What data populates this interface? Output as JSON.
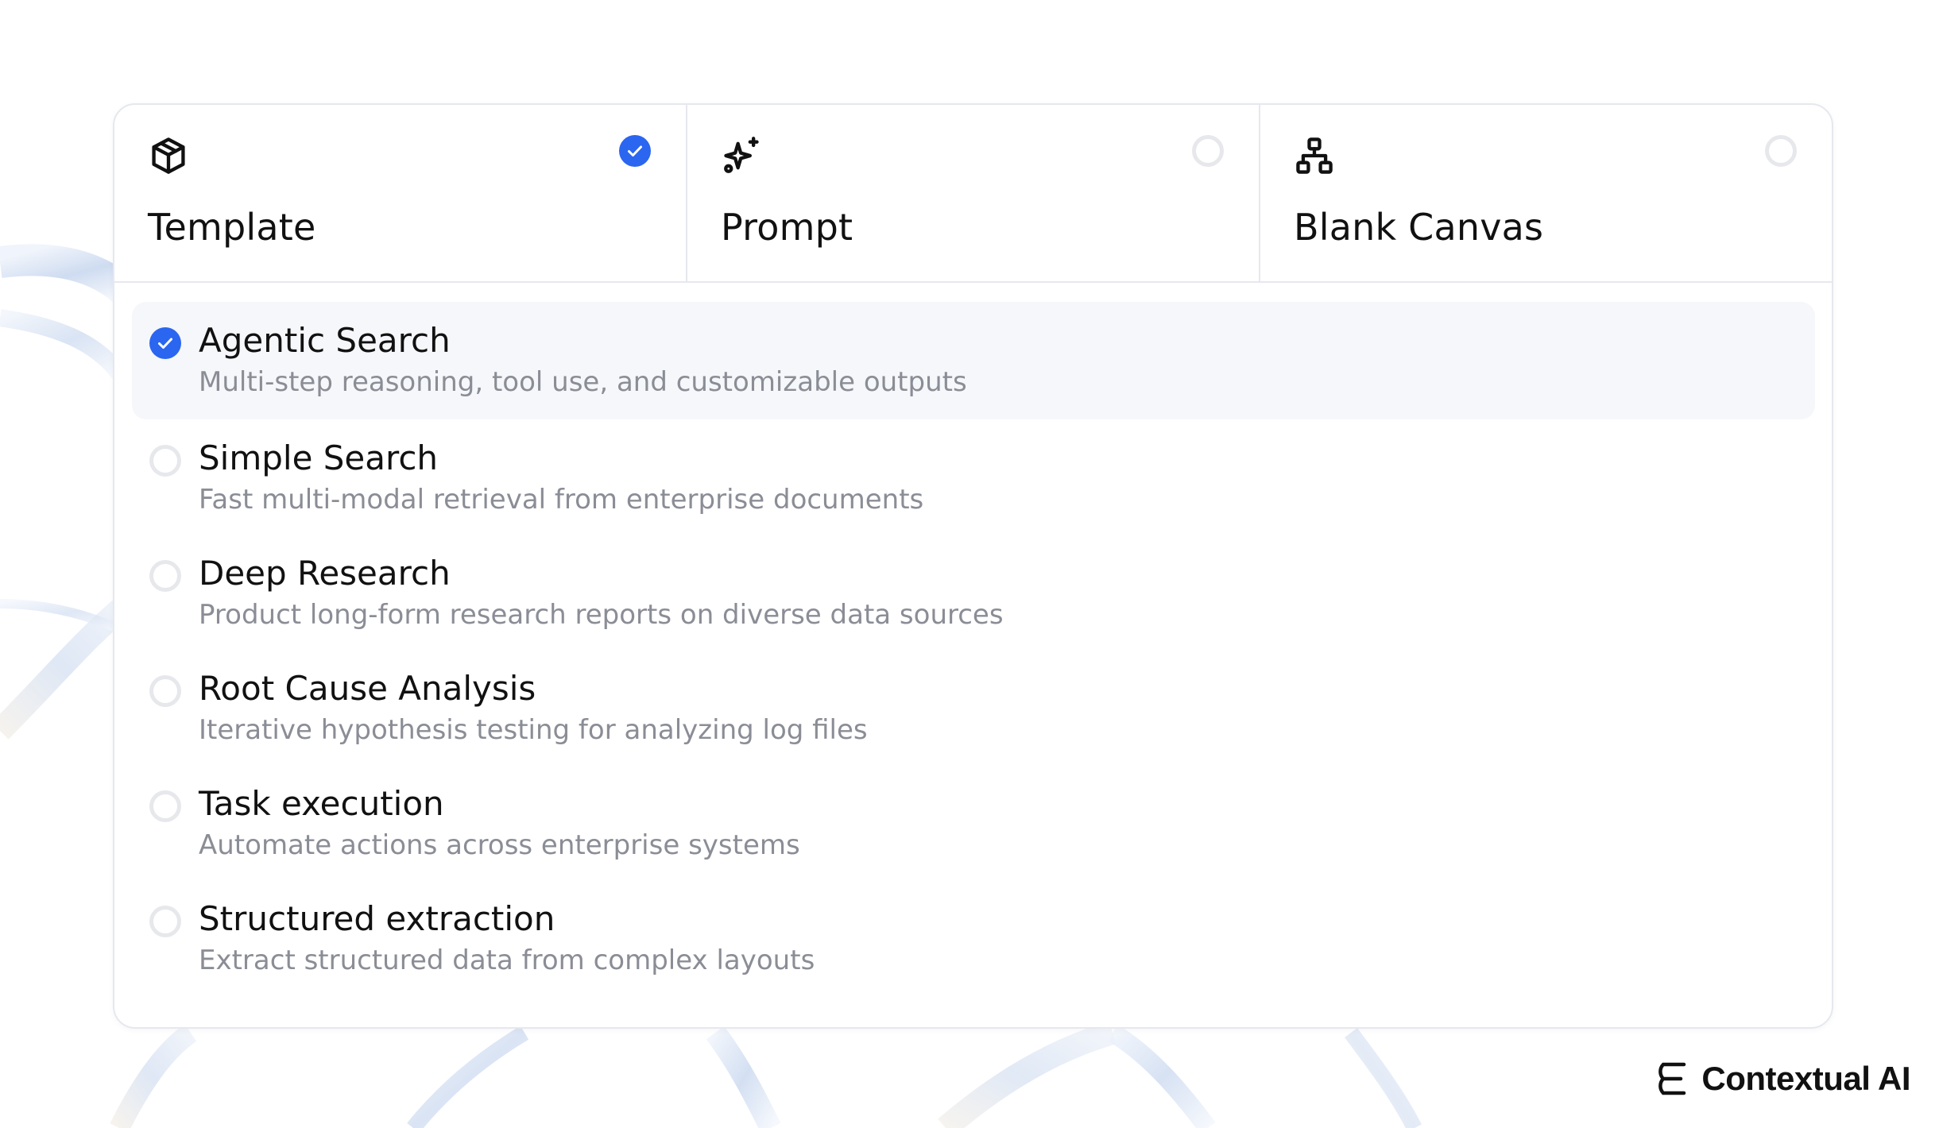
{
  "modes": [
    {
      "id": "template",
      "label": "Template",
      "icon": "cube-icon",
      "selected": true
    },
    {
      "id": "prompt",
      "label": "Prompt",
      "icon": "sparkles-icon",
      "selected": false
    },
    {
      "id": "blank-canvas",
      "label": "Blank Canvas",
      "icon": "workflow-icon",
      "selected": false
    }
  ],
  "templates": [
    {
      "title": "Agentic Search",
      "description": "Multi-step reasoning, tool use, and customizable outputs",
      "selected": true
    },
    {
      "title": "Simple Search",
      "description": "Fast multi-modal retrieval from enterprise documents",
      "selected": false
    },
    {
      "title": "Deep Research",
      "description": "Product long-form research reports on diverse data sources",
      "selected": false
    },
    {
      "title": "Root Cause Analysis",
      "description": "Iterative hypothesis testing for analyzing log files",
      "selected": false
    },
    {
      "title": "Task execution",
      "description": "Automate actions across enterprise systems",
      "selected": false
    },
    {
      "title": "Structured extraction",
      "description": "Extract structured data from complex layouts",
      "selected": false
    }
  ],
  "brand": {
    "name": "Contextual AI",
    "icon": "contextual-logo-icon"
  },
  "colors": {
    "accent": "#2a66f0",
    "text_primary": "#111111",
    "text_secondary": "#8b8d96",
    "border": "#e6e8ee",
    "selected_bg": "#f6f7fa"
  }
}
